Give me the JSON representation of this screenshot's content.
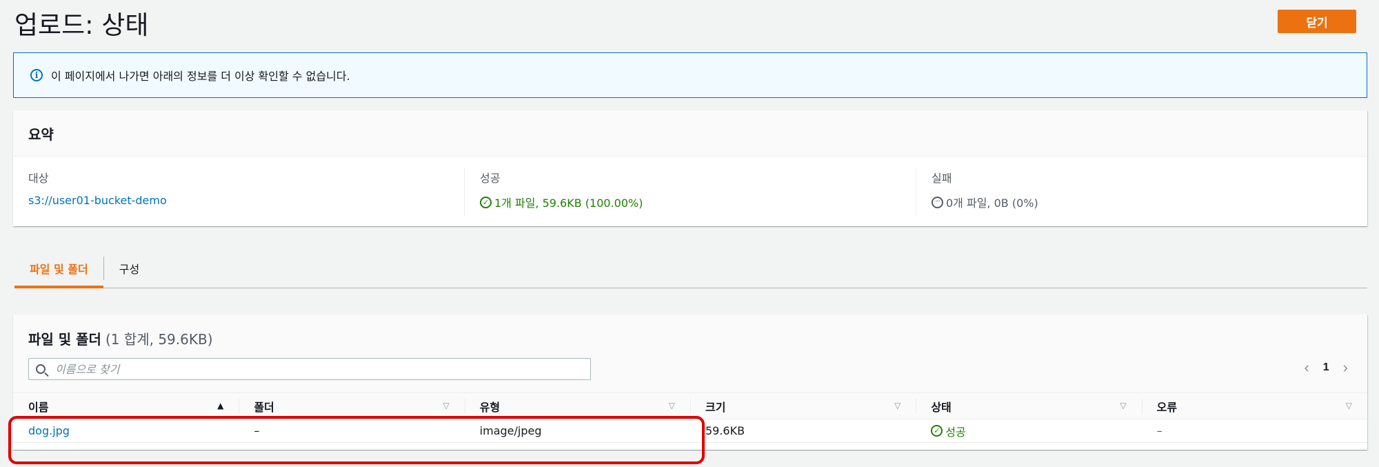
{
  "header": {
    "title": "업로드: 상태",
    "close_label": "닫기"
  },
  "alert": {
    "icon": "info-icon",
    "text": "이 페이지에서 나가면 아래의 정보를 더 이상 확인할 수 없습니다."
  },
  "summary": {
    "title": "요약",
    "destination": {
      "label": "대상",
      "value": "s3://user01-bucket-demo"
    },
    "success": {
      "label": "성공",
      "value": "1개 파일, 59.6KB (100.00%)"
    },
    "failure": {
      "label": "실패",
      "value": "0개 파일, 0B (0%)"
    }
  },
  "tabs": [
    {
      "label": "파일 및 폴더",
      "active": true
    },
    {
      "label": "구성",
      "active": false
    }
  ],
  "files": {
    "title": "파일 및 폴더",
    "count": "(1 합계, 59.6KB)",
    "search_placeholder": "이름으로 찾기",
    "page": "1",
    "columns": [
      "이름",
      "폴더",
      "유형",
      "크기",
      "상태",
      "오류"
    ],
    "rows": [
      {
        "name": "dog.jpg",
        "folder": "–",
        "type": "image/jpeg",
        "size": "59.6KB",
        "status": "성공",
        "error": "–"
      }
    ]
  },
  "colors": {
    "accent": "#ec7211",
    "link": "#0073bb",
    "success": "#1d8102",
    "highlight": "#e00000"
  }
}
